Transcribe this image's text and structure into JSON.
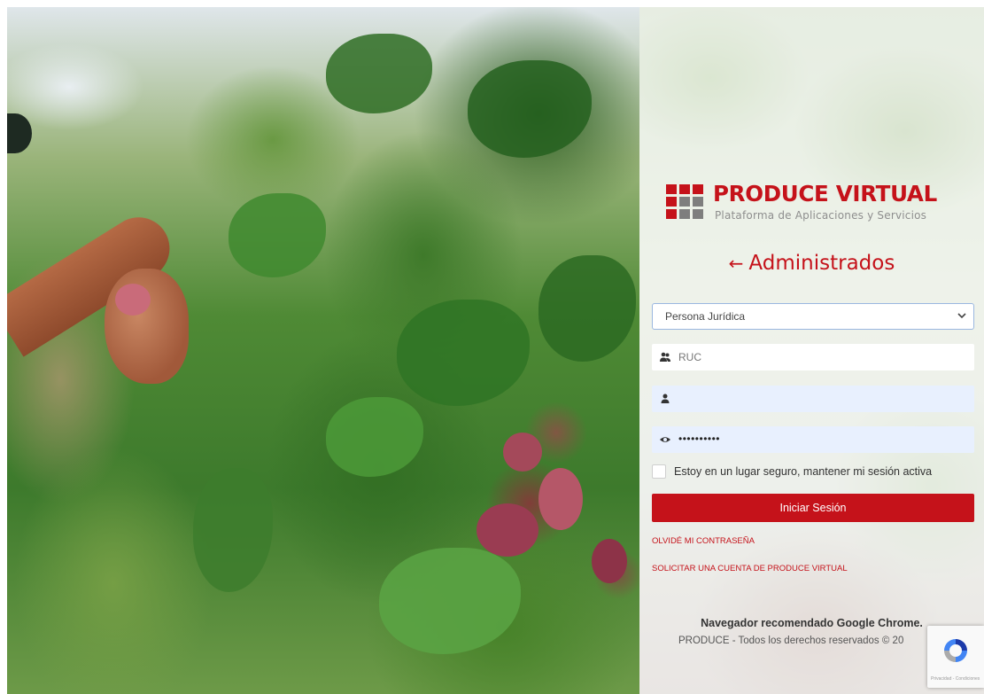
{
  "brand": {
    "title": "PRODUCE VIRTUAL",
    "subtitle": "Plataforma de Aplicaciones y Servicios",
    "accent_color": "#c5121a"
  },
  "section": {
    "back_arrow": "←",
    "title": "Administrados"
  },
  "form": {
    "person_type": {
      "selected": "Persona Jurídica"
    },
    "ruc": {
      "placeholder": "RUC",
      "value": "",
      "icon": "users-icon"
    },
    "username": {
      "value": "",
      "icon": "user-icon"
    },
    "password": {
      "value": "••••••••••",
      "icon": "eye-icon"
    },
    "remember": {
      "label": "Estoy en un lugar seguro, mantener mi sesión activa",
      "checked": false
    },
    "submit_label": "Iniciar Sesión"
  },
  "links": {
    "forgot_password": "OLVIDÉ MI CONTRASEÑA",
    "request_account": "SOLICITAR UNA CUENTA DE PRODUCE VIRTUAL"
  },
  "footer": {
    "browser_note": "Navegador recomendado Google Chrome.",
    "copyright": "PRODUCE - Todos los derechos reservados © 20"
  },
  "recaptcha": {
    "terms": "Privacidad - Condiciones"
  }
}
